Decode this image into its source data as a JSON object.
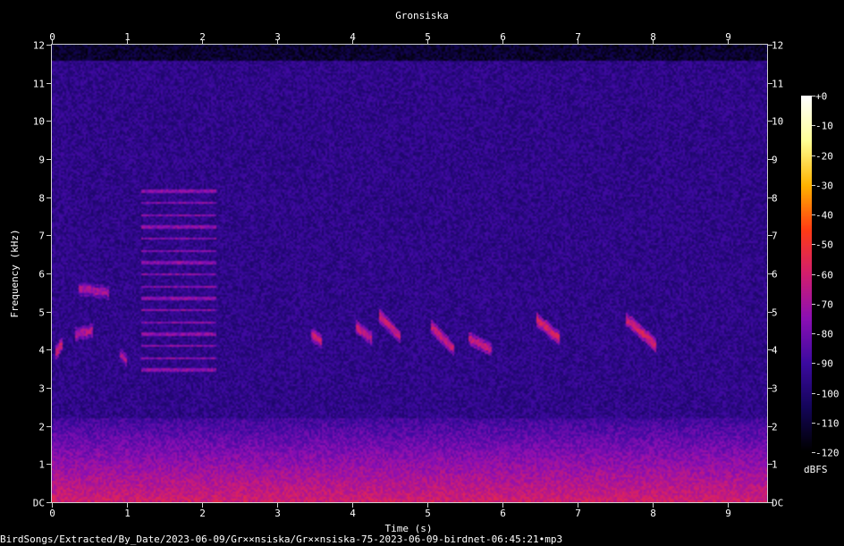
{
  "chart_data": {
    "type": "heatmap",
    "subtype": "spectrogram",
    "title": "Gronsiska",
    "xlabel": "Time (s)",
    "ylabel": "Frequency (kHz)",
    "xlim": [
      0,
      9.52
    ],
    "ylim": [
      0,
      12
    ],
    "x_ticks": [
      0,
      1,
      2,
      3,
      4,
      5,
      6,
      7,
      8,
      9
    ],
    "y_ticks": [
      "DC",
      "1",
      "2",
      "3",
      "4",
      "5",
      "6",
      "7",
      "8",
      "9",
      "10",
      "11",
      "12"
    ],
    "colorbar": {
      "label": "dBFS",
      "range": [
        -120,
        0
      ],
      "ticks": [
        "+0",
        "-10",
        "-20",
        "-30",
        "-40",
        "-50",
        "-60",
        "-70",
        "-80",
        "-90",
        "-100",
        "-110",
        "-120"
      ],
      "colors": [
        "#000000",
        "#14055a",
        "#3c0aa0",
        "#8c0fb4",
        "#d21e6e",
        "#ff3c14",
        "#ffb400",
        "#ffff96",
        "#ffffff"
      ]
    },
    "signal_ceiling_khz": 11.6,
    "noise_floor_dbfs": -95,
    "features": [
      {
        "kind": "lowfreq_noise",
        "t0": 0,
        "t1": 9.52,
        "f0": 0,
        "f1": 2.2,
        "level": -60
      },
      {
        "kind": "tone",
        "t0": 0.05,
        "t1": 0.15,
        "f0": 3.9,
        "f1": 4.2,
        "level": -62
      },
      {
        "kind": "tone",
        "t0": 0.3,
        "t1": 0.55,
        "f0": 4.4,
        "f1": 4.5,
        "level": -68
      },
      {
        "kind": "tone",
        "t0": 0.35,
        "t1": 0.75,
        "f0": 5.6,
        "f1": 5.5,
        "level": -70
      },
      {
        "kind": "tone",
        "t0": 0.9,
        "t1": 1.0,
        "f0": 3.9,
        "f1": 3.7,
        "level": -68
      },
      {
        "kind": "harmonic_stack",
        "t0": 1.2,
        "t1": 2.2,
        "f0": 3.2,
        "f1": 8.2,
        "level": -75
      },
      {
        "kind": "tone",
        "t0": 3.45,
        "t1": 3.6,
        "f0": 4.4,
        "f1": 4.2,
        "level": -62
      },
      {
        "kind": "tone",
        "t0": 4.05,
        "t1": 4.25,
        "f0": 4.6,
        "f1": 4.3,
        "level": -64
      },
      {
        "kind": "tone",
        "t0": 4.35,
        "t1": 4.65,
        "f0": 4.9,
        "f1": 4.3,
        "level": -64
      },
      {
        "kind": "tone",
        "t0": 5.05,
        "t1": 5.35,
        "f0": 4.6,
        "f1": 4.0,
        "level": -63
      },
      {
        "kind": "tone",
        "t0": 5.55,
        "t1": 5.85,
        "f0": 4.3,
        "f1": 4.0,
        "level": -64
      },
      {
        "kind": "tone",
        "t0": 6.45,
        "t1": 6.75,
        "f0": 4.8,
        "f1": 4.3,
        "level": -60
      },
      {
        "kind": "tone",
        "t0": 7.65,
        "t1": 8.05,
        "f0": 4.8,
        "f1": 4.1,
        "level": -60
      }
    ]
  },
  "footer": {
    "path": "BirdSongs/Extracted/By_Date/2023-06-09/Gr××nsiska/Gr××nsiska-75-2023-06-09-birdnet-06:45:21•mp3"
  }
}
